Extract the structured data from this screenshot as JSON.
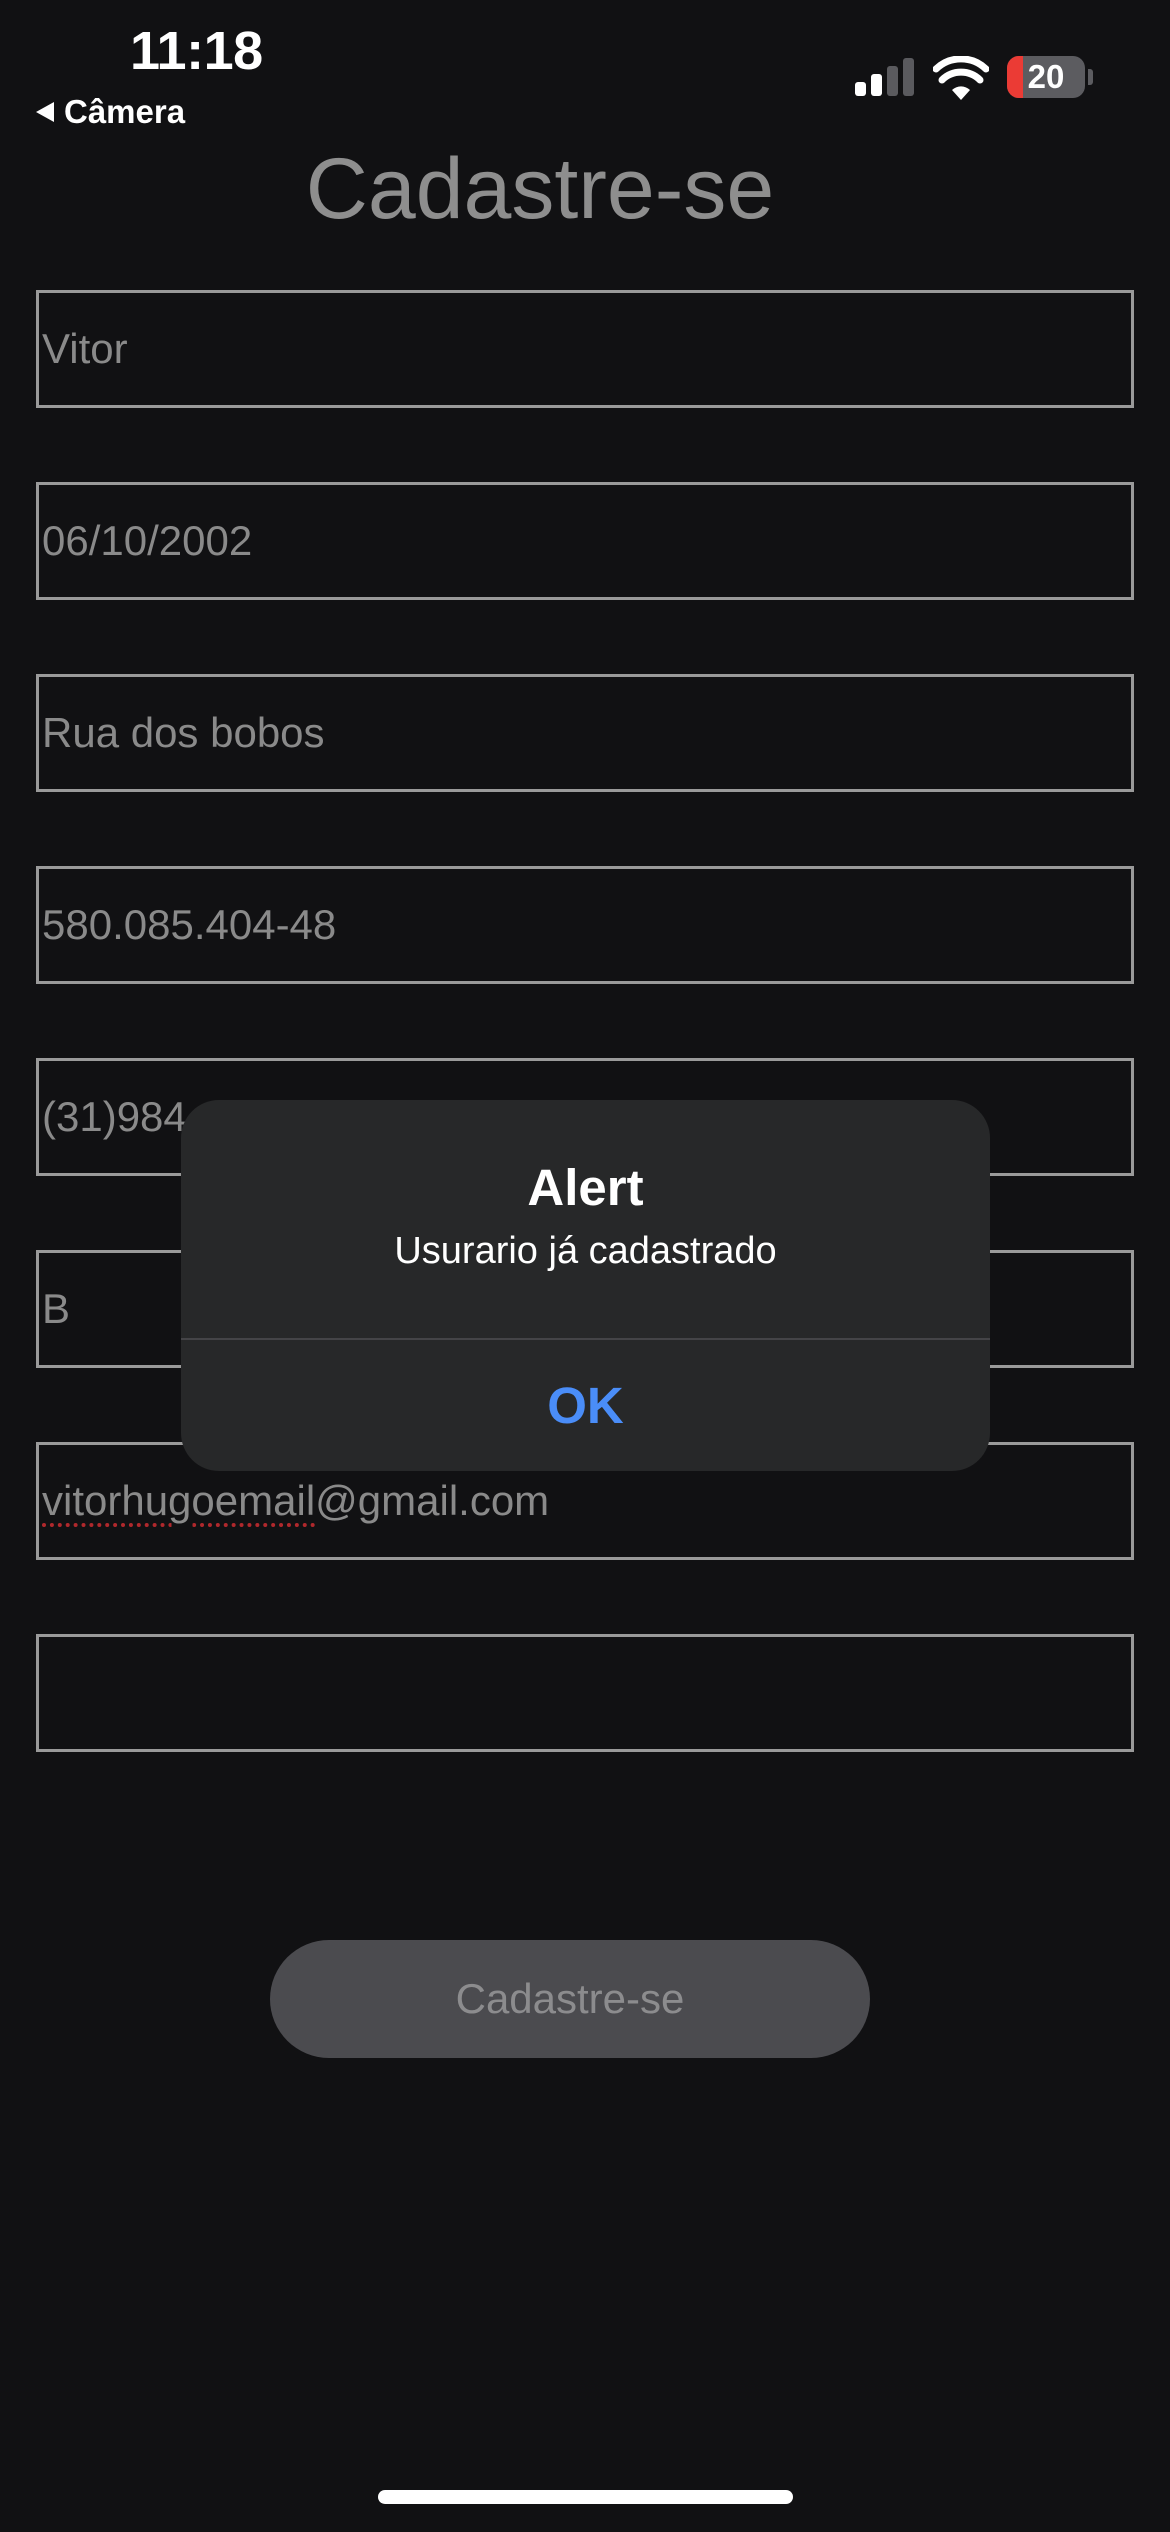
{
  "status_bar": {
    "time": "11:18",
    "back_label": "Câmera",
    "battery_percent": "20",
    "battery_level": 0.2,
    "battery_level_color": "#eb3b35",
    "signal_bars_active": 2,
    "signal_bars_total": 4
  },
  "page": {
    "title": "Cadastre-se",
    "fields": {
      "name": "Vitor",
      "birth_date": "06/10/2002",
      "address": "Rua dos bobos",
      "cpf": "580.085.404-48",
      "phone_visible": "(31)984",
      "field6_visible": "B",
      "email_user": "vitorhugoemail",
      "email_domain": "@gmail.com",
      "password": ""
    },
    "submit_label": "Cadastre-se"
  },
  "alert": {
    "title": "Alert",
    "message": "Usurario já cadastrado",
    "ok_label": "OK",
    "ok_color": "#4a8df8"
  },
  "colors": {
    "background": "#111113",
    "field_border": "#9a9a9a",
    "alert_background": "#272829"
  }
}
